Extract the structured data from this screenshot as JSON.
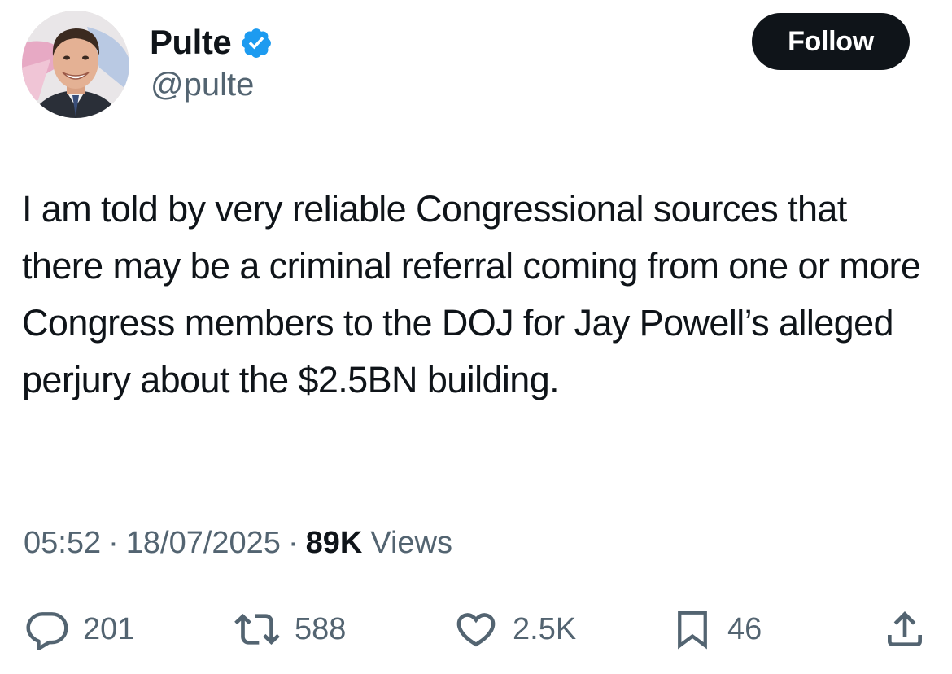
{
  "author": {
    "display_name": "Pulte",
    "handle": "@pulte",
    "verified": true
  },
  "follow_button": {
    "label": "Follow"
  },
  "tweet": {
    "text": "I am told by very reliable Congressional sources that there may be a criminal referral coming from one or more Congress members to the DOJ for Jay Powell’s alleged perjury about the $2.5BN building."
  },
  "meta": {
    "time": "05:52",
    "separator": "·",
    "date": "18/07/2025",
    "views_count": "89K",
    "views_label": "Views"
  },
  "actions": {
    "reply": {
      "icon": "reply-icon",
      "count": "201"
    },
    "repost": {
      "icon": "repost-icon",
      "count": "588"
    },
    "like": {
      "icon": "heart-icon",
      "count": "2.5K"
    },
    "bookmark": {
      "icon": "bookmark-icon",
      "count": "46"
    },
    "share": {
      "icon": "share-icon"
    }
  },
  "colors": {
    "text_primary": "#0f1419",
    "text_secondary": "#536471",
    "verified_blue": "#1d9bf0",
    "button_bg": "#0f1419"
  }
}
